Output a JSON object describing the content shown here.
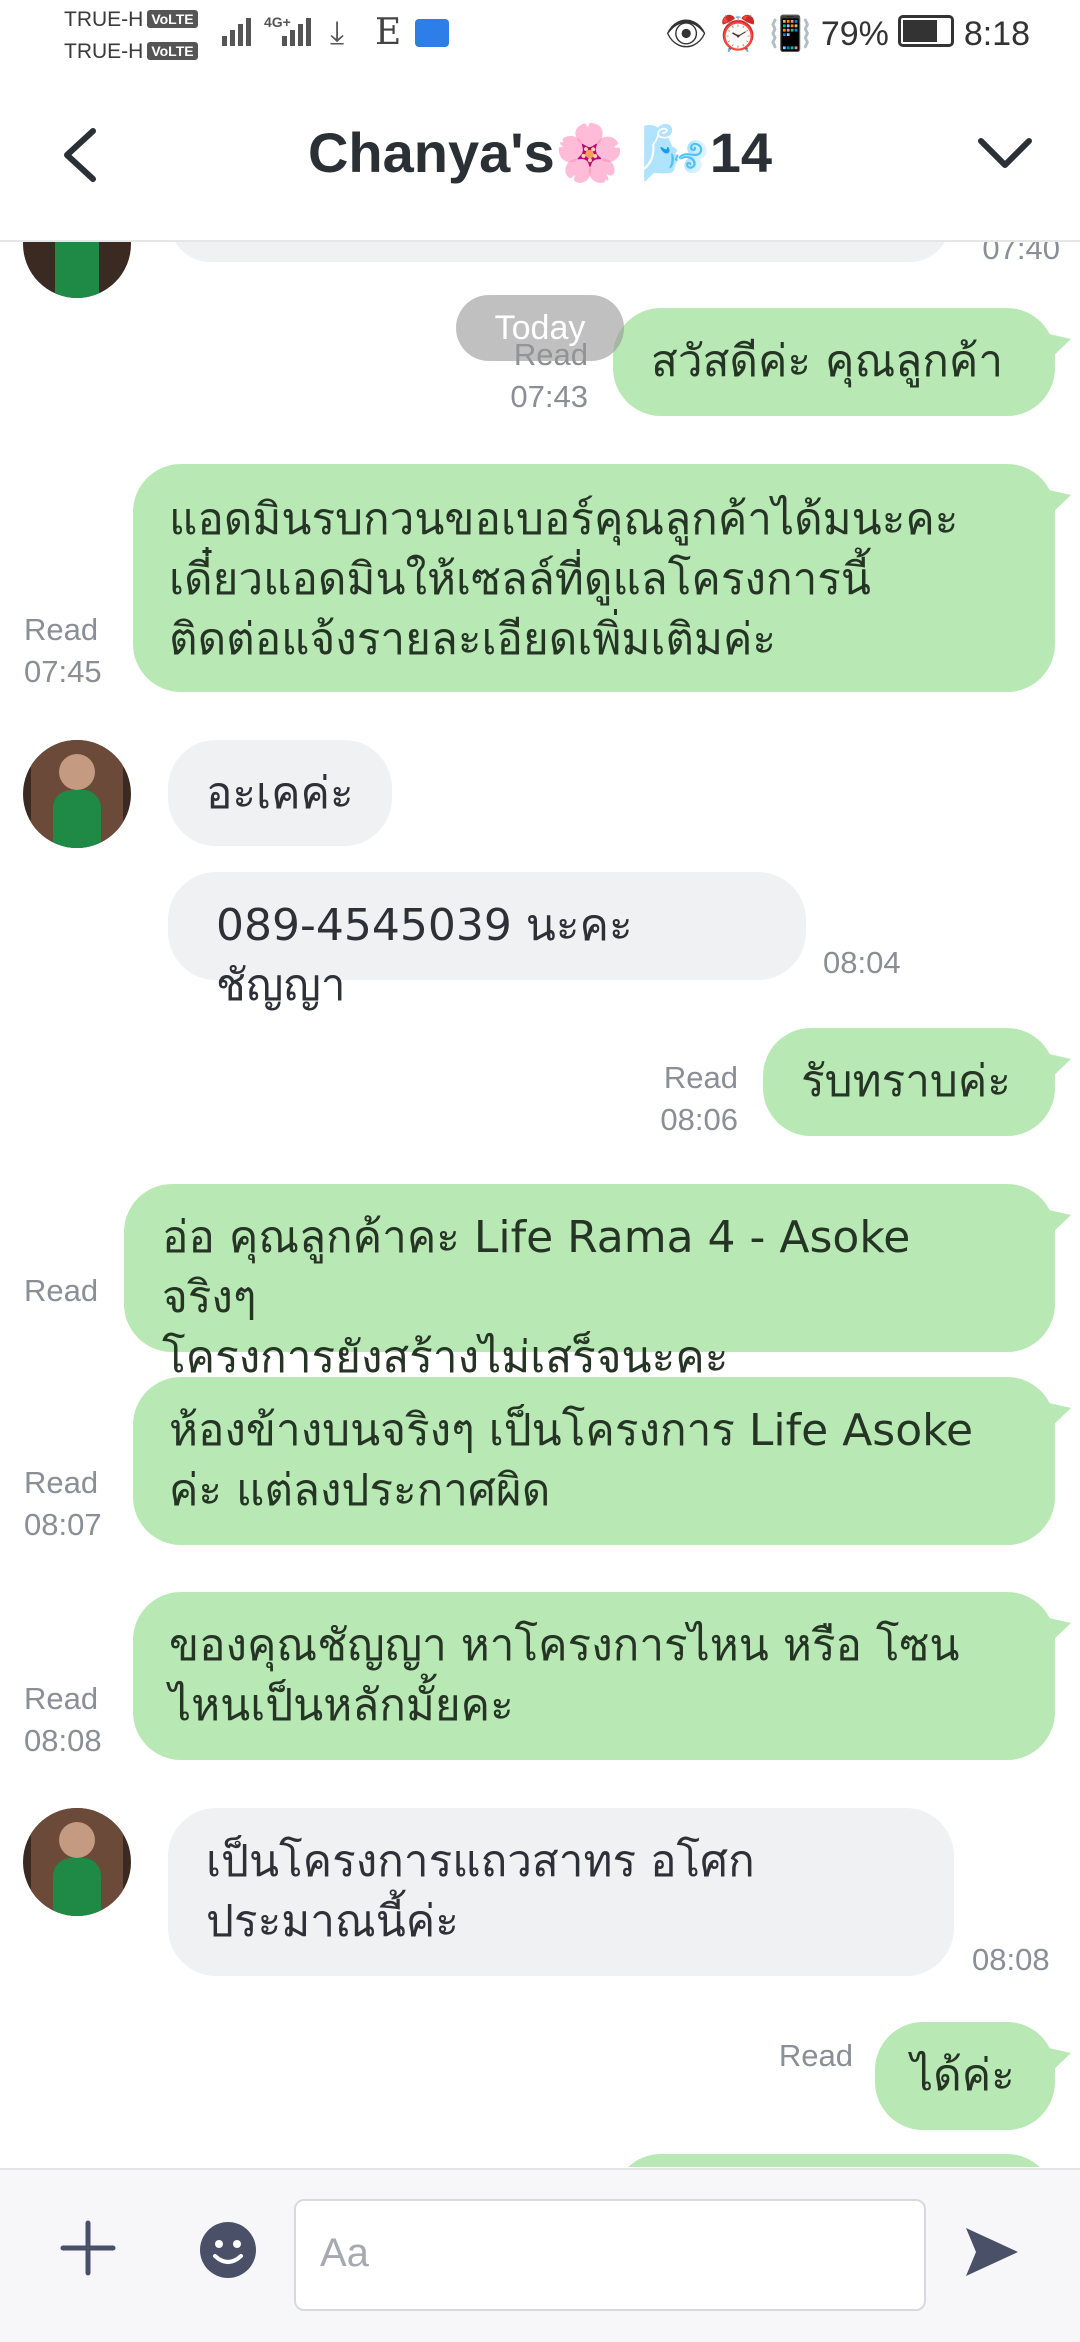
{
  "status_bar": {
    "carrier1": "TRUE-H",
    "carrier2": "TRUE-H",
    "volte": "VoLTE",
    "net_type": "4G+",
    "data_letter": "E",
    "battery": "79%",
    "time": "8:18"
  },
  "header": {
    "title": "Chanya's🌸 🌬️14"
  },
  "chat": {
    "date_chip": "Today",
    "partial_time": "07:40",
    "messages": [
      {
        "from": "me",
        "text": "สวัสดีค่ะ คุณลูกค้า",
        "read": "Read",
        "time": "07:43"
      },
      {
        "from": "me",
        "lines": [
          "แอดมินรบกวนขอเบอร์คุณลูกค้าได้มนะคะ",
          "เดี๋ยวแอดมินให้เซลล์ที่ดูแลโครงการนี้",
          "ติดต่อแจ้งรายละเอียดเพิ่มเติมค่ะ"
        ],
        "read": "Read",
        "time": "07:45"
      },
      {
        "from": "them",
        "text": "อะเคค่ะ"
      },
      {
        "from": "them",
        "text": "089-4545039 นะคะ ชัญญา",
        "time": "08:04"
      },
      {
        "from": "me",
        "text": "รับทราบค่ะ",
        "read": "Read",
        "time": "08:06"
      },
      {
        "from": "me",
        "lines": [
          "อ่อ คุณลูกค้าคะ Life Rama 4 - Asoke จริงๆ",
          "โครงการยังสร้างไม่เสร็จนะคะ"
        ],
        "read": "Read"
      },
      {
        "from": "me",
        "lines": [
          "ห้องข้างบนจริงๆ เป็นโครงการ Life Asoke",
          "ค่ะ แต่ลงประกาศผิด"
        ],
        "read": "Read",
        "time": "08:07"
      },
      {
        "from": "me",
        "lines": [
          "ของคุณชัญญา หาโครงการไหน หรือ โซน",
          "ไหนเป็นหลักมั้ยคะ"
        ],
        "read": "Read",
        "time": "08:08"
      },
      {
        "from": "them",
        "lines": [
          "เป็นโครงการแถวสาทร อโศก",
          "ประมาณนี้ค่ะ"
        ],
        "time": "08:08"
      },
      {
        "from": "me",
        "text": "ได้ค่ะ",
        "read": "Read"
      }
    ]
  },
  "input_bar": {
    "placeholder": "Aa"
  },
  "colors": {
    "outgoing_bubble": "#b8e9b4",
    "incoming_bubble": "#f0f1f3",
    "meta_text": "#8a8e95"
  }
}
